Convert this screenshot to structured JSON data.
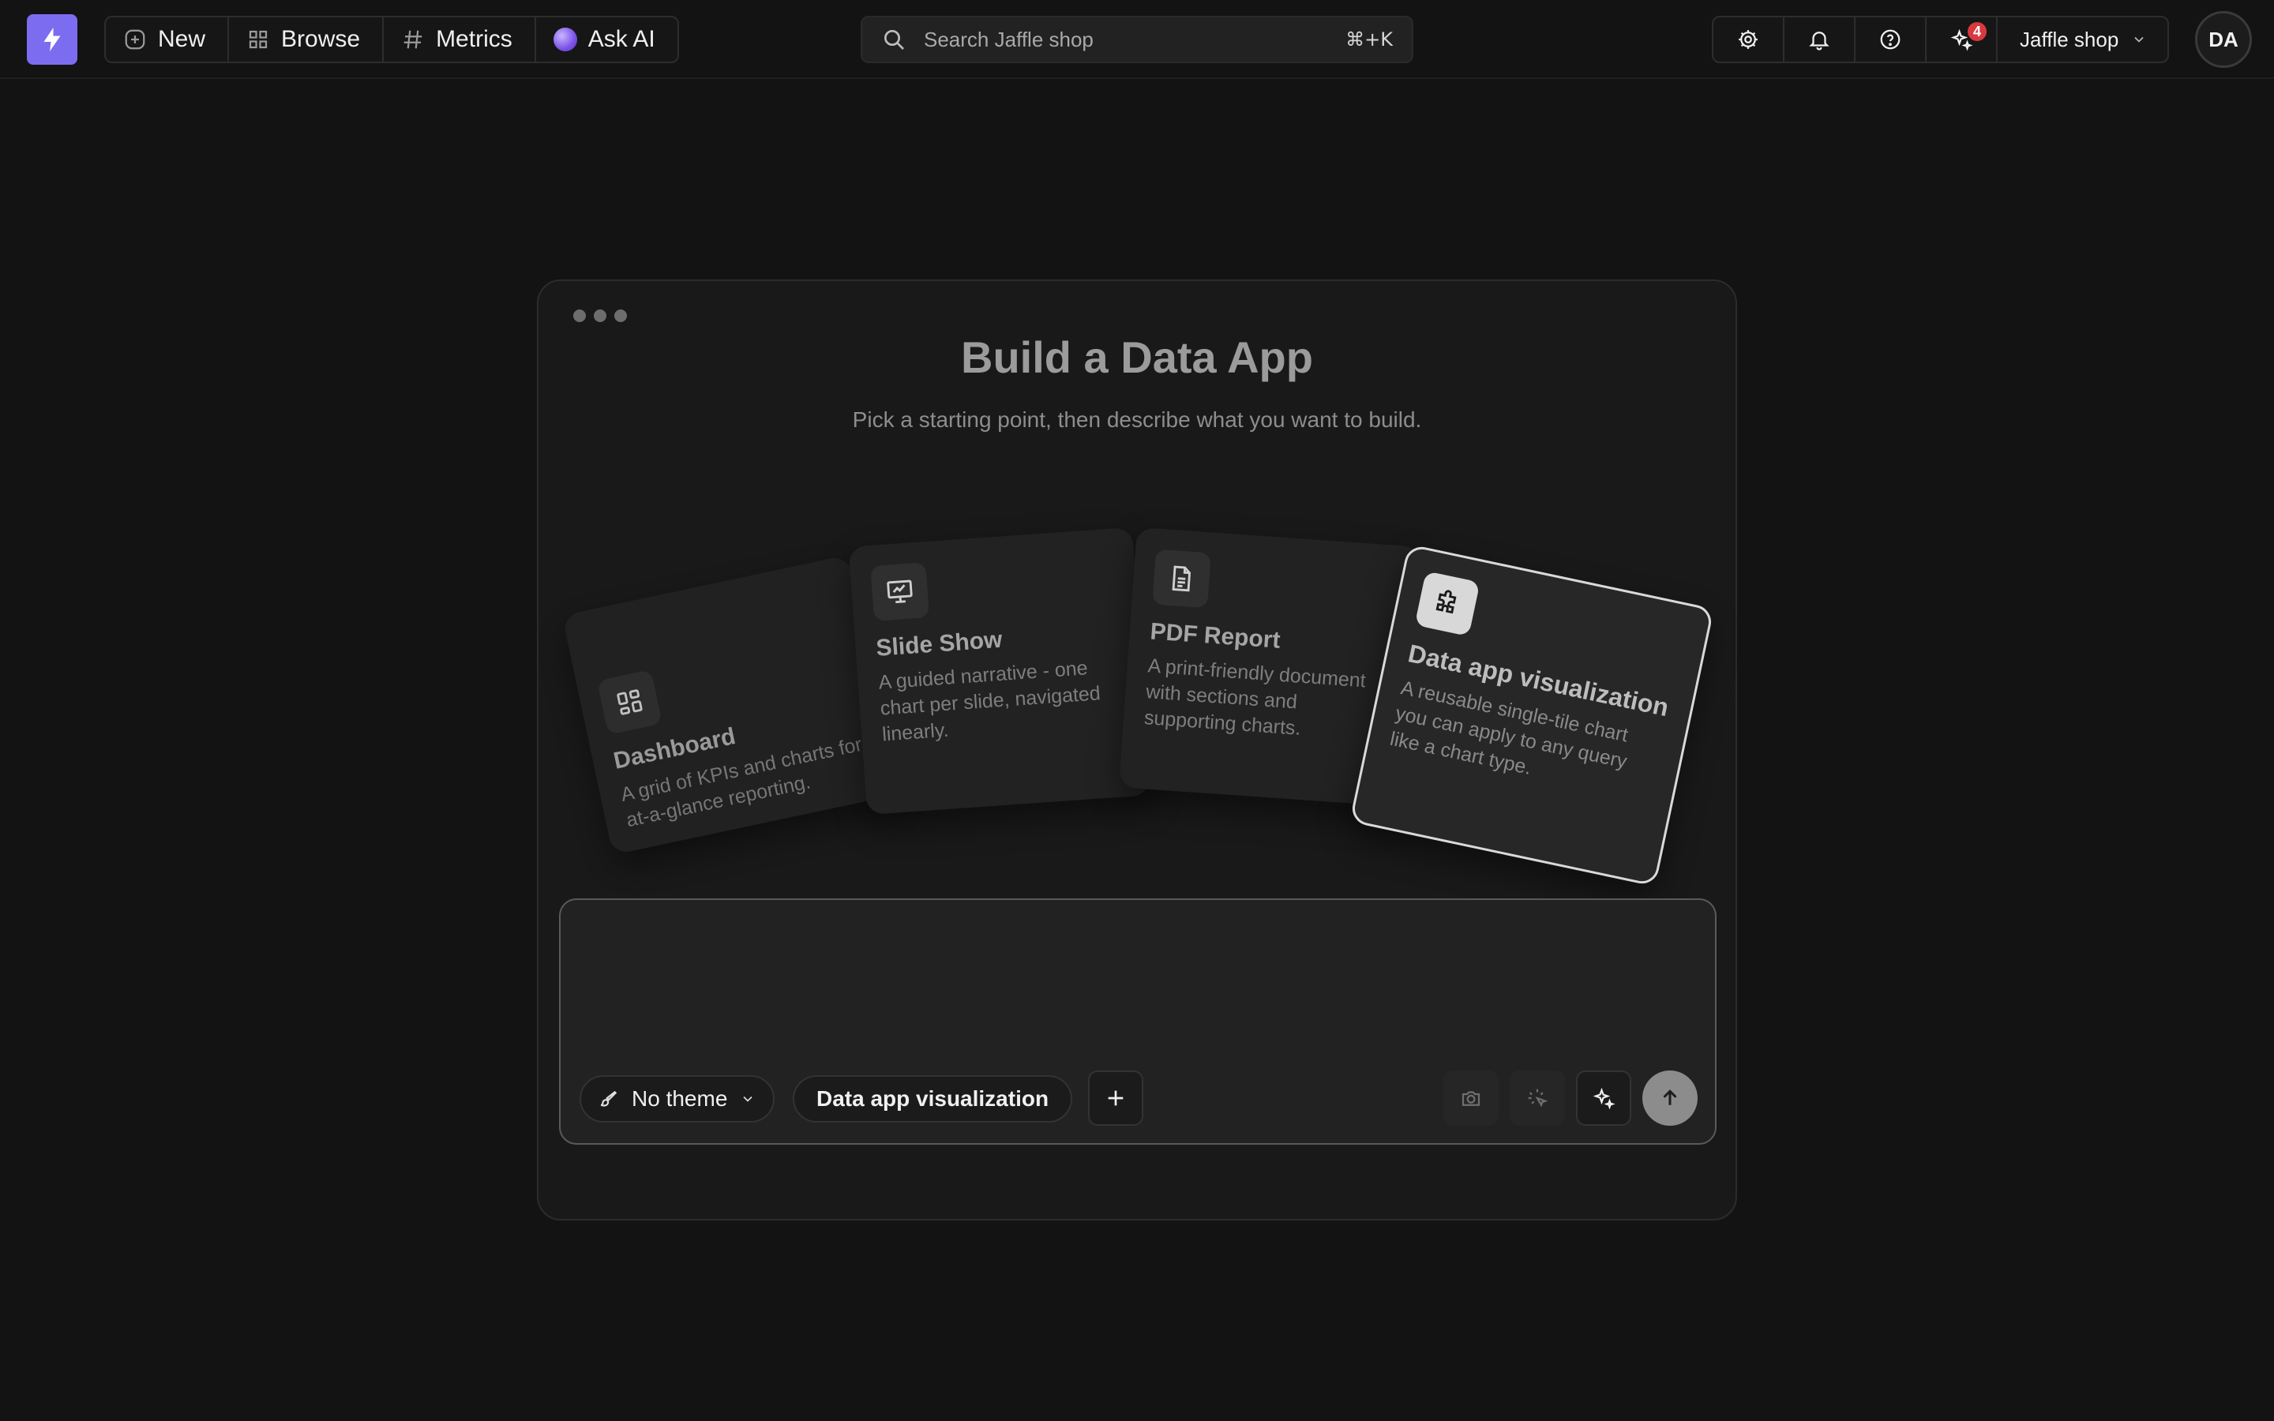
{
  "nav": {
    "new_label": "New",
    "browse_label": "Browse",
    "metrics_label": "Metrics",
    "ask_ai_label": "Ask AI"
  },
  "search": {
    "placeholder": "Search Jaffle shop",
    "shortcut": "⌘+K"
  },
  "header_right": {
    "notification_badge": "4",
    "workspace_name": "Jaffle shop",
    "avatar_initials": "DA"
  },
  "builder": {
    "title": "Build a Data App",
    "subtitle": "Pick a starting point, then describe what you want to build.",
    "cards": [
      {
        "title": "Dashboard",
        "description": "A grid of KPIs and charts for at-a-glance reporting.",
        "icon": "dashboard-icon"
      },
      {
        "title": "Slide Show",
        "description": "A guided narrative - one chart per slide, navigated linearly.",
        "icon": "presentation-icon"
      },
      {
        "title": "PDF Report",
        "description": "A print-friendly document with sections and supporting charts.",
        "icon": "document-icon"
      },
      {
        "title": "Data app visualization",
        "description": "A reusable single-tile chart you can apply to any query like a chart type.",
        "icon": "puzzle-icon",
        "selected": true
      }
    ]
  },
  "prompt": {
    "input_value": "",
    "theme_label": "No theme",
    "type_label": "Data app visualization"
  },
  "colors": {
    "brand": "#7c6cf0",
    "background": "#131313",
    "panel": "#191919",
    "badge": "#d9393e"
  }
}
